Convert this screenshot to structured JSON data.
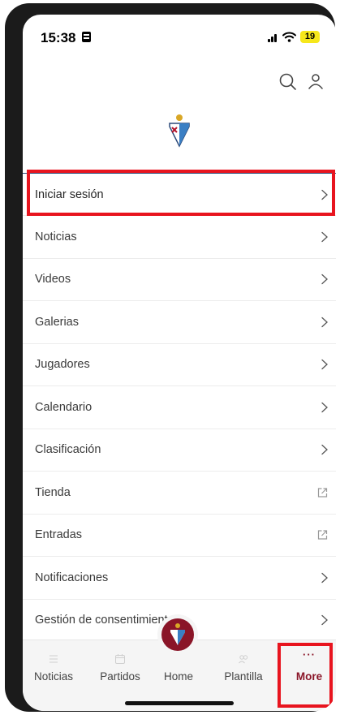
{
  "status_bar": {
    "time": "15:38",
    "battery": "19"
  },
  "header": {
    "search_icon": "search-icon",
    "user_icon": "user-icon"
  },
  "logo": "club-crest",
  "menu": {
    "items": [
      {
        "label": "Iniciar sesión",
        "icon": "chevron-right-icon"
      },
      {
        "label": "Noticias",
        "icon": "chevron-right-icon"
      },
      {
        "label": "Videos",
        "icon": "chevron-right-icon"
      },
      {
        "label": "Galerias",
        "icon": "chevron-right-icon"
      },
      {
        "label": "Jugadores",
        "icon": "chevron-right-icon"
      },
      {
        "label": "Calendario",
        "icon": "chevron-right-icon"
      },
      {
        "label": "Clasificación",
        "icon": "chevron-right-icon"
      },
      {
        "label": "Tienda",
        "icon": "external-link-icon"
      },
      {
        "label": "Entradas",
        "icon": "external-link-icon"
      },
      {
        "label": "Notificaciones",
        "icon": "chevron-right-icon"
      },
      {
        "label": "Gestión de consentimientos",
        "icon": "chevron-right-icon"
      }
    ]
  },
  "tab_bar": {
    "tabs": [
      {
        "label": "Noticias",
        "icon": "list-icon"
      },
      {
        "label": "Partidos",
        "icon": "calendar-icon"
      },
      {
        "label": "Home",
        "icon": "club-crest"
      },
      {
        "label": "Plantilla",
        "icon": "team-icon"
      },
      {
        "label": "More",
        "icon": "more-dots-icon",
        "dots": "···",
        "active": true
      }
    ]
  },
  "colors": {
    "accent": "#8a1528",
    "highlight": "#e8141e",
    "divider": "#2c4a7a"
  }
}
